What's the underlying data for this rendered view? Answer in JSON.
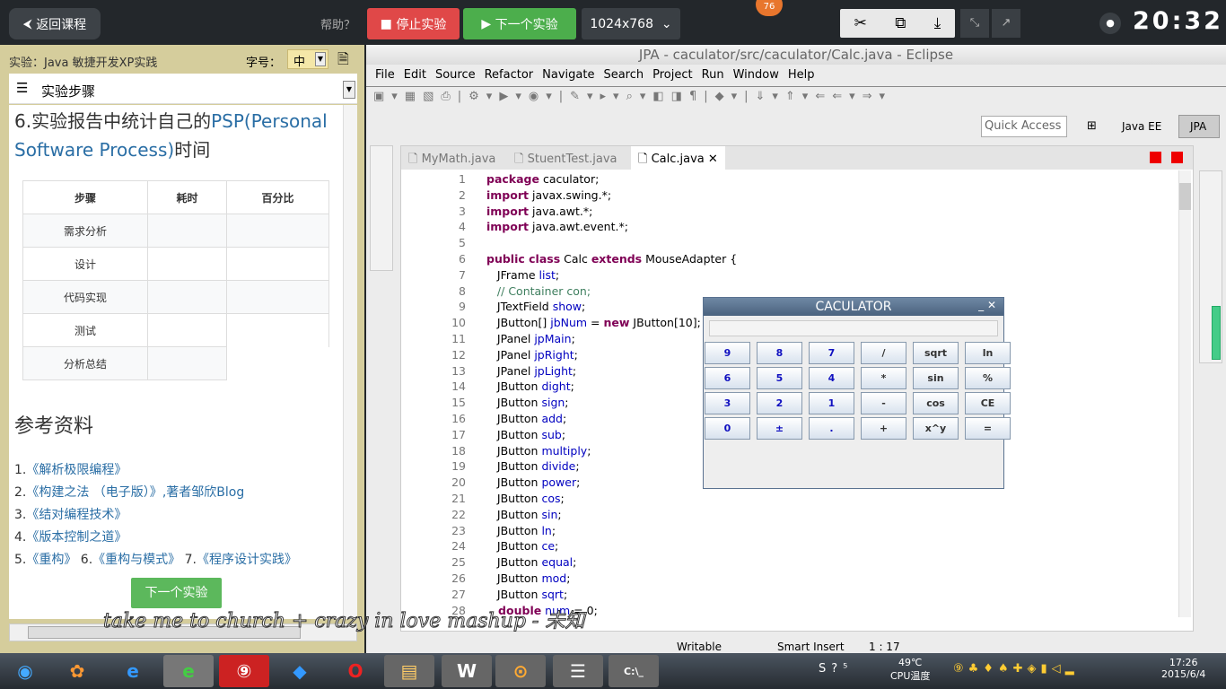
{
  "topbar": {
    "back": "返回课程",
    "help": "帮助？",
    "stop": "停止实验",
    "next": "下一个实验",
    "resolution": "1024x768",
    "badge": "76",
    "clock": "20:32",
    "icons": [
      "scissors-icon",
      "screen-share-icon",
      "download-icon",
      "fullscreen-exit-icon",
      "external-link-icon",
      "eye-icon"
    ]
  },
  "left": {
    "lab_title": "实验：Java 敏捷开发XP实践",
    "font_label": "字号：",
    "font_value": "中",
    "steps_label": "实验步骤",
    "heading_a": "6.实验报告中统计自己的",
    "heading_link": "PSP(Personal Software Process)",
    "heading_b": "时间",
    "table": {
      "headers": [
        "步骤",
        "耗时",
        "百分比"
      ],
      "rows": [
        "需求分析",
        "设计",
        "代码实现",
        "测试",
        "分析总结"
      ]
    },
    "refs_title": "参考资料",
    "refs": [
      {
        "n": "1.",
        "t": "《解析极限编程》"
      },
      {
        "n": "2.",
        "t": "《构建之法 （电子版）》",
        "extra": ",著者邹欣Blog"
      },
      {
        "n": "3.",
        "t": "《结对编程技术》"
      },
      {
        "n": "4.",
        "t": "《版本控制之道》"
      }
    ],
    "refs_line5": [
      {
        "n": "5.",
        "t": "《重构》"
      },
      {
        "n": " 6.",
        "t": "《重构与模式》"
      },
      {
        "n": " 7.",
        "t": "《程序设计实践》"
      }
    ],
    "next_button": "下一个实验"
  },
  "eclipse": {
    "title": "JPA - caculator/src/caculator/Calc.java - Eclipse",
    "menu": [
      "File",
      "Edit",
      "Source",
      "Refactor",
      "Navigate",
      "Search",
      "Project",
      "Run",
      "Window",
      "Help"
    ],
    "quick_access": "Quick Access",
    "perspectives": [
      "Java EE",
      "JPA"
    ],
    "tabs": [
      "MyMath.java",
      "StuentTest.java",
      "Calc.java"
    ],
    "code": [
      [
        [
          "k",
          "package"
        ],
        [
          "t",
          " caculator;"
        ]
      ],
      [
        [
          "k",
          "import"
        ],
        [
          "t",
          " javax.swing.*;"
        ]
      ],
      [
        [
          "k",
          "import"
        ],
        [
          "t",
          " java.awt.*;"
        ]
      ],
      [
        [
          "k",
          "import"
        ],
        [
          "t",
          " java.awt.event.*;"
        ]
      ],
      [],
      [
        [
          "k",
          "public class"
        ],
        [
          "t",
          " Calc "
        ],
        [
          "k",
          "extends"
        ],
        [
          "t",
          " MouseAdapter {"
        ]
      ],
      [
        [
          "t",
          "   JFrame "
        ],
        [
          "f",
          "list"
        ],
        [
          "t",
          ";"
        ]
      ],
      [
        [
          "c",
          "   // Container con;"
        ]
      ],
      [
        [
          "t",
          "   JTextField "
        ],
        [
          "f",
          "show"
        ],
        [
          "t",
          ";"
        ]
      ],
      [
        [
          "t",
          "   JButton[] "
        ],
        [
          "f",
          "jbNum"
        ],
        [
          "t",
          " = "
        ],
        [
          "k",
          "new"
        ],
        [
          "t",
          " JButton[10];"
        ]
      ],
      [
        [
          "t",
          "   JPanel "
        ],
        [
          "f",
          "jpMain"
        ],
        [
          "t",
          ";"
        ]
      ],
      [
        [
          "t",
          "   JPanel "
        ],
        [
          "f",
          "jpRight"
        ],
        [
          "t",
          ";"
        ]
      ],
      [
        [
          "t",
          "   JPanel "
        ],
        [
          "f",
          "jpLight"
        ],
        [
          "t",
          ";"
        ]
      ],
      [
        [
          "t",
          "   JButton "
        ],
        [
          "f",
          "dight"
        ],
        [
          "t",
          ";"
        ]
      ],
      [
        [
          "t",
          "   JButton "
        ],
        [
          "f",
          "sign"
        ],
        [
          "t",
          ";"
        ]
      ],
      [
        [
          "t",
          "   JButton "
        ],
        [
          "f",
          "add"
        ],
        [
          "t",
          ";"
        ]
      ],
      [
        [
          "t",
          "   JButton "
        ],
        [
          "f",
          "sub"
        ],
        [
          "t",
          ";"
        ]
      ],
      [
        [
          "t",
          "   JButton "
        ],
        [
          "f",
          "multiply"
        ],
        [
          "t",
          ";"
        ]
      ],
      [
        [
          "t",
          "   JButton "
        ],
        [
          "f",
          "divide"
        ],
        [
          "t",
          ";"
        ]
      ],
      [
        [
          "t",
          "   JButton "
        ],
        [
          "f",
          "power"
        ],
        [
          "t",
          ";"
        ]
      ],
      [
        [
          "t",
          "   JButton "
        ],
        [
          "f",
          "cos"
        ],
        [
          "t",
          ";"
        ]
      ],
      [
        [
          "t",
          "   JButton "
        ],
        [
          "f",
          "sin"
        ],
        [
          "t",
          ";"
        ]
      ],
      [
        [
          "t",
          "   JButton "
        ],
        [
          "f",
          "ln"
        ],
        [
          "t",
          ";"
        ]
      ],
      [
        [
          "t",
          "   JButton "
        ],
        [
          "f",
          "ce"
        ],
        [
          "t",
          ";"
        ]
      ],
      [
        [
          "t",
          "   JButton "
        ],
        [
          "f",
          "equal"
        ],
        [
          "t",
          ";"
        ]
      ],
      [
        [
          "t",
          "   JButton "
        ],
        [
          "f",
          "mod"
        ],
        [
          "t",
          ";"
        ]
      ],
      [
        [
          "t",
          "   JButton "
        ],
        [
          "f",
          "sqrt"
        ],
        [
          "t",
          ";"
        ]
      ],
      [
        [
          "k",
          "   double"
        ],
        [
          "f",
          " num"
        ],
        [
          "t",
          " = 0;"
        ]
      ]
    ],
    "status": [
      "Writable",
      "Smart Insert",
      "1 : 17"
    ]
  },
  "calculator": {
    "title": "CACULATOR",
    "display": "",
    "buttons": [
      [
        "9",
        "8",
        "7",
        "/",
        "sqrt",
        "ln"
      ],
      [
        "6",
        "5",
        "4",
        "*",
        "sin",
        "%"
      ],
      [
        "3",
        "2",
        "1",
        "-",
        "cos",
        "CE"
      ],
      [
        "0",
        "±",
        ".",
        "+",
        "x^y",
        "="
      ]
    ]
  },
  "overlay": "take me to church + crazy in love mashup - 未知",
  "taskbar": {
    "temp": "49℃",
    "temp_label": "CPU温度",
    "time": "17:26",
    "date": "2015/6/4"
  },
  "colors": {
    "stop": "#e04848",
    "next": "#4cae4c",
    "keyword": "#7f0055",
    "field": "#0000c0",
    "comment": "#3f7f5f"
  }
}
